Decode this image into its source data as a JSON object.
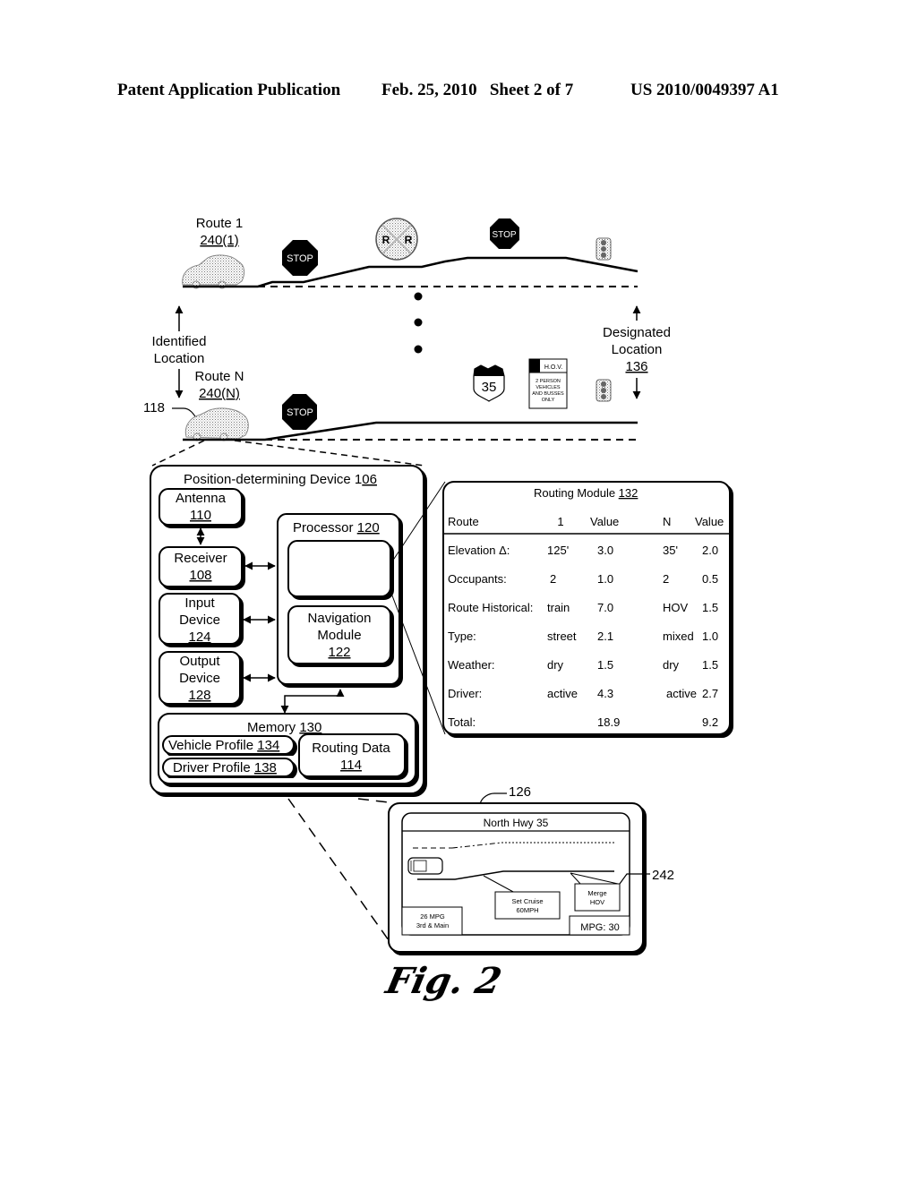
{
  "header": {
    "left": "Patent Application Publication",
    "middle": "Feb. 25, 2010   Sheet 2 of 7",
    "right": "US 2010/0049397 A1"
  },
  "routes": {
    "route1_label": "Route 1",
    "route1_ref": "240(1)",
    "routeN_label": "Route N",
    "routeN_ref": "240(N)",
    "vehicle_ref": "118",
    "identified_location_line1": "Identified",
    "identified_location_line2": "Location",
    "designated_location_line1": "Designated",
    "designated_location_line2": "Location",
    "designated_location_ref": "136",
    "stop_sign": "STOP",
    "rr_sign_left": "R",
    "rr_sign_right": "R",
    "highway_shield": "35",
    "hov_sign_title": "H.O.V.",
    "hov_sign_lines": [
      "2 PERSON",
      "VEHICLES",
      "AND BUSSES",
      "ONLY"
    ]
  },
  "device": {
    "title": "Position-determining Device 1",
    "title_ref": "06",
    "antenna": {
      "label": "Antenna",
      "ref": "110"
    },
    "receiver": {
      "label": "Receiver",
      "ref": "108"
    },
    "input_device": {
      "label1": "Input",
      "label2": "Device",
      "ref": "124"
    },
    "output_device": {
      "label1": "Output",
      "label2": "Device",
      "ref": "128"
    },
    "processor": {
      "label": "Processor ",
      "ref": "120"
    },
    "navigation_module": {
      "label1": "Navigation",
      "label2": "Module",
      "ref": "122"
    },
    "memory": {
      "label": "Memory ",
      "ref": "130"
    },
    "vehicle_profile": {
      "label": "Vehicle Profile ",
      "ref": "134"
    },
    "driver_profile": {
      "label": "Driver Profile ",
      "ref": "138"
    },
    "routing_data": {
      "label": "Routing Data",
      "ref": "114"
    }
  },
  "routing_module": {
    "title": "Routing Module ",
    "title_ref": "132",
    "columns": [
      "Route",
      "1",
      "Value",
      "N",
      "Value"
    ],
    "rows": [
      [
        "Elevation Δ:",
        "125'",
        "3.0",
        "35'",
        "2.0"
      ],
      [
        "Occupants:",
        "2",
        "1.0",
        "2",
        "0.5"
      ],
      [
        "Route Historical:",
        "train",
        "7.0",
        "HOV",
        "1.5"
      ],
      [
        "Type:",
        "street",
        "2.1",
        "mixed",
        "1.0"
      ],
      [
        "Weather:",
        "dry",
        "1.5",
        "dry",
        "1.5"
      ],
      [
        "Driver:",
        "active",
        "4.3",
        "active",
        "2.7"
      ],
      [
        "Total:",
        "",
        "18.9",
        "",
        "9.2"
      ]
    ]
  },
  "display": {
    "ref": "126",
    "callout_ref": "242",
    "street": "North Hwy 35",
    "set_cruise_line1": "Set Cruise",
    "set_cruise_line2": "60MPH",
    "merge_line1": "Merge",
    "merge_line2": "HOV",
    "mpg_line1": "26 MPG",
    "mpg_line2": "3rd & Main",
    "mpg_current": "MPG: 30"
  },
  "figure_label": "Fig. 2"
}
